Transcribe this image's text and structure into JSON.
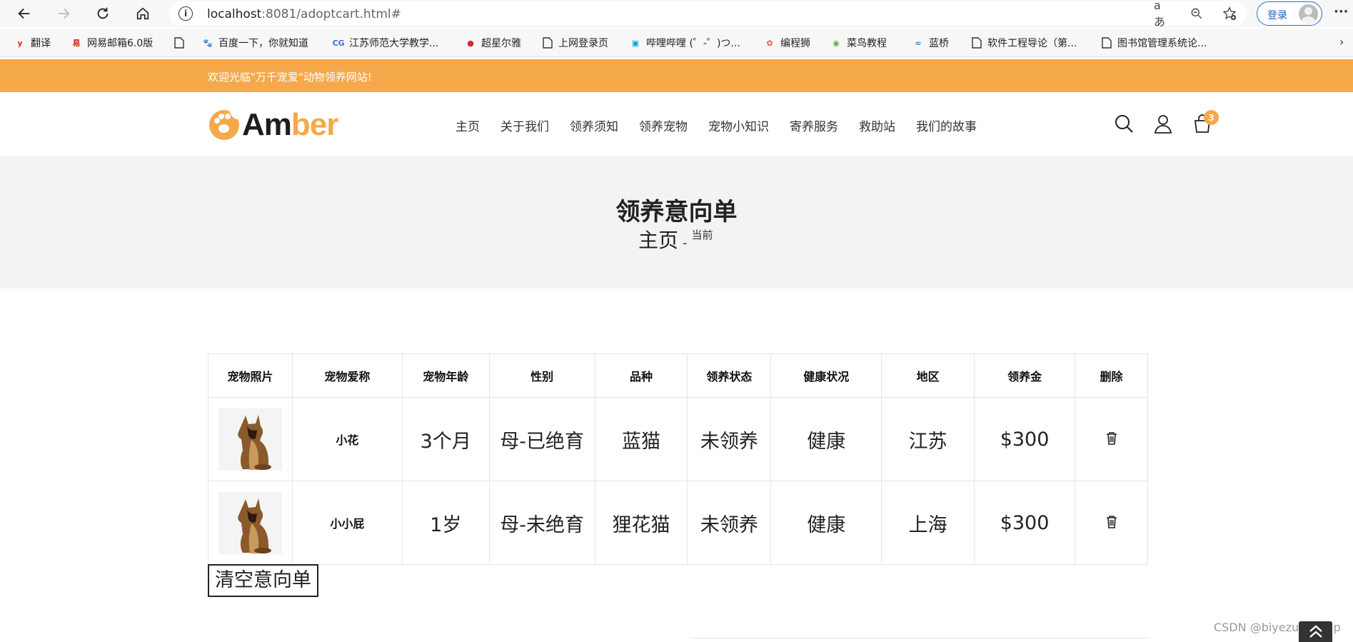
{
  "browser": {
    "url_host": "localhost",
    "url_rest": ":8081/adoptcart.html#",
    "login_label": "登录",
    "translate_glyph": "aあ",
    "bookmarks": [
      {
        "label": "翻译",
        "icon": "youdao-icon"
      },
      {
        "label": "网易邮箱6.0版",
        "icon": "netease-mail-icon"
      },
      {
        "label": "",
        "icon": "page-icon"
      },
      {
        "label": "百度一下，你就知道",
        "icon": "baidu-icon"
      },
      {
        "label": "江苏师范大学教学...",
        "icon": "jsnu-icon"
      },
      {
        "label": "超星尔雅",
        "icon": "chaoxing-icon"
      },
      {
        "label": "上网登录页",
        "icon": "page-icon"
      },
      {
        "label": "哔哩哔哩 (゜-゜)つ...",
        "icon": "bilibili-icon"
      },
      {
        "label": "编程狮",
        "icon": "w3cschool-icon"
      },
      {
        "label": "菜鸟教程",
        "icon": "runoob-icon"
      },
      {
        "label": "蓝桥",
        "icon": "lanqiao-icon"
      },
      {
        "label": "软件工程导论（第...",
        "icon": "page-icon"
      },
      {
        "label": "图书馆管理系统论...",
        "icon": "page-icon"
      }
    ]
  },
  "site": {
    "welcome": "欢迎光临\"万千宠爱\"动物领养网站!",
    "logo_text_dark": "Am",
    "logo_text_orange": "ber",
    "nav": [
      "主页",
      "关于我们",
      "领养须知",
      "领养宠物",
      "宠物小知识",
      "寄养服务",
      "救助站",
      "我们的故事"
    ],
    "cart_count": "3",
    "page_title": "领养意向单",
    "breadcrumb_home": "主页",
    "breadcrumb_sep": "-",
    "breadcrumb_current": "当前"
  },
  "table": {
    "headers": [
      "宠物照片",
      "宠物爱称",
      "宠物年龄",
      "性别",
      "品种",
      "领养状态",
      "健康状况",
      "地区",
      "领养金",
      "删除"
    ],
    "rows": [
      {
        "nickname": "小花",
        "age": "3个月",
        "gender": "母-已绝育",
        "breed": "蓝猫",
        "status": "未领养",
        "health": "健康",
        "region": "江苏",
        "fee": "$300"
      },
      {
        "nickname": "小小屁",
        "age": "1岁",
        "gender": "母-未绝育",
        "breed": "狸花猫",
        "status": "未领养",
        "health": "健康",
        "region": "上海",
        "fee": "$300"
      }
    ]
  },
  "clear_button": "清空意向单",
  "watermark": "CSDN @biyezuopinvip",
  "colors": {
    "accent": "#f5a94a",
    "hero_bg": "#f3f3f3"
  }
}
